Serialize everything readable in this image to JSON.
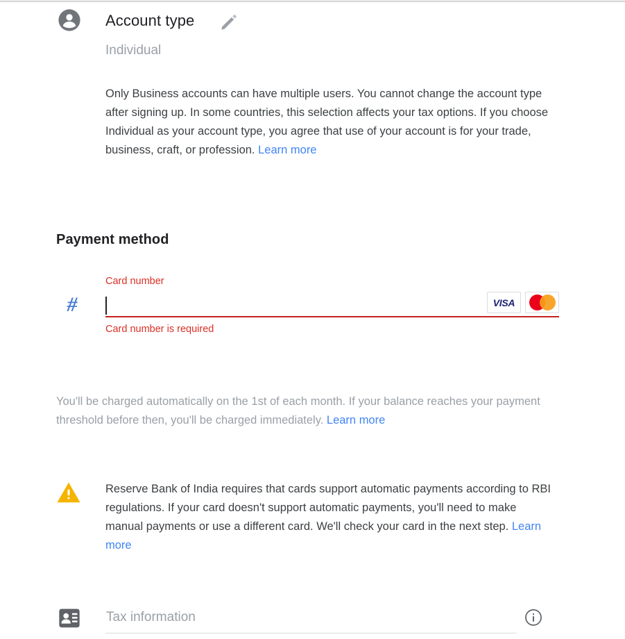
{
  "account_type": {
    "icon": "account-circle-icon",
    "title": "Account type",
    "edit_icon": "pencil-edit-icon",
    "value": "Individual",
    "description_before": "Only Business accounts can have multiple users. You cannot change the account type after signing up. In some countries, this selection affects your tax options. If you choose Individual as your account type, you agree that use of your account is for your trade, business, craft, or profession. ",
    "learn_more": "Learn more"
  },
  "payment_method": {
    "heading": "Payment method",
    "hash_icon": "number-hash-icon",
    "hash_glyph": "#",
    "card_number_label": "Card number",
    "card_number_value": "",
    "card_number_placeholder": "",
    "card_number_error": "Card number is required",
    "accepted_cards": [
      {
        "name": "visa-logo",
        "label": "VISA"
      },
      {
        "name": "mastercard-logo",
        "label": ""
      }
    ],
    "charge_note_before": "You'll be charged automatically on the 1st of each month. If your balance reaches your payment threshold before then, you'll be charged immediately. ",
    "charge_note_learn_more": "Learn more"
  },
  "rbi_notice": {
    "icon": "warning-triangle-icon",
    "text_before": "Reserve Bank of India requires that cards support automatic payments according to RBI regulations. If your card doesn't support automatic payments, you'll need to make manual payments or use a different card. We'll check your card in the next step. ",
    "learn_more": "Learn more"
  },
  "tax_information": {
    "icon": "contact-card-icon",
    "label": "Tax information",
    "info_icon": "info-circle-icon"
  },
  "colors": {
    "error_red": "#d93025",
    "underline_red": "#c5221f",
    "link_blue": "#4285f4",
    "hash_blue": "#4a7fd4",
    "muted_gray": "#9aa0a6",
    "text_gray": "#3c4043",
    "warning_amber": "#f5b400",
    "visa_blue": "#1a1f71",
    "mc_red": "#eb001b",
    "mc_orange": "#f79e1b"
  }
}
